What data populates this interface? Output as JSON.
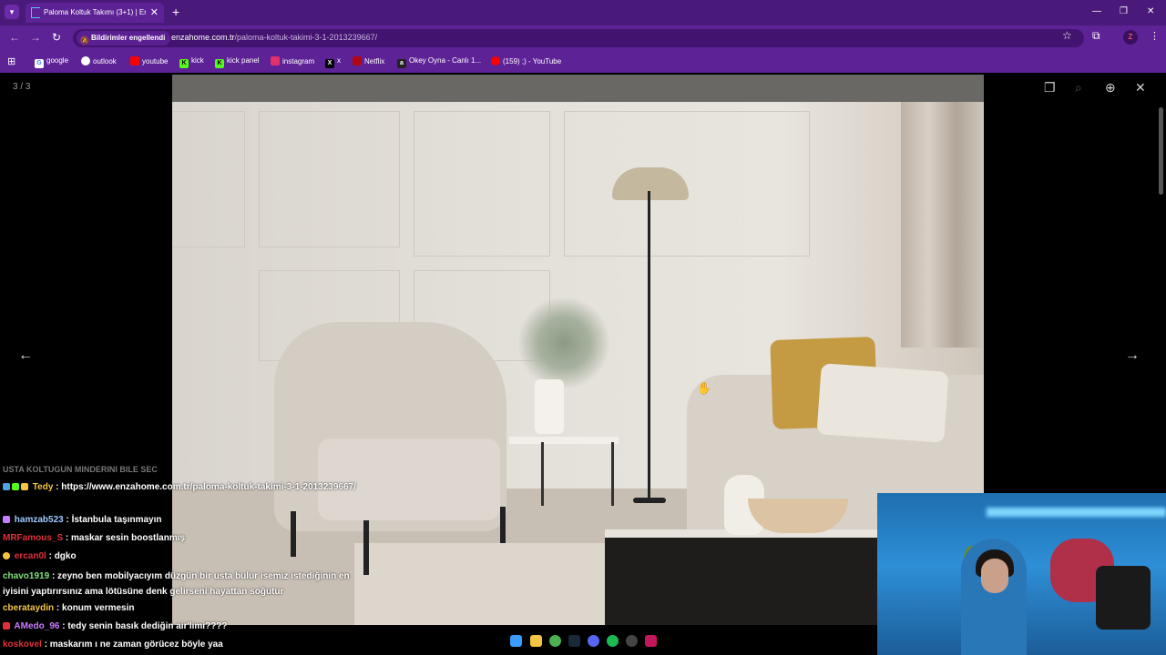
{
  "browser": {
    "tab_title": "Paloma Koltuk Takımı (3+1) | En",
    "tab_close": "✕",
    "new_tab": "+",
    "window_controls": [
      "—",
      "❐",
      "✕"
    ],
    "notifications_blocked": "Bildirimler engellendi",
    "url_domain": "enzahome.com.tr",
    "url_path": "/paloma-koltuk-takimi-3-1-2013239667/",
    "profile_initial": "Z"
  },
  "bookmarks": [
    {
      "label": "google",
      "icon": "google-icon",
      "color": "#ffffff"
    },
    {
      "label": "outlook",
      "icon": "outlook-icon",
      "color": "#ffffff"
    },
    {
      "label": "youtube",
      "icon": "youtube-icon",
      "color": "#ff0000"
    },
    {
      "label": "kick",
      "icon": "kick-icon",
      "color": "#53fc18"
    },
    {
      "label": "kick panel",
      "icon": "kick-icon",
      "color": "#53fc18"
    },
    {
      "label": "instagram",
      "icon": "instagram-icon",
      "color": "#e1306c"
    },
    {
      "label": "x",
      "icon": "x-icon",
      "color": "#000000"
    },
    {
      "label": "Netflix",
      "icon": "netflix-icon",
      "color": "#b20710"
    },
    {
      "label": "Okey Oyna - Canlı 1...",
      "icon": "okey-icon",
      "color": "#222222"
    },
    {
      "label": "(159) ;) - YouTube",
      "icon": "youtube-icon",
      "color": "#ff0000"
    }
  ],
  "lightbox": {
    "counter": "3 / 3"
  },
  "chat": {
    "faded_message": "USTA KOLTUGUN MINDERINI BILE SEC",
    "messages": [
      {
        "user": "Tedy",
        "color": "#f5c542",
        "text": ": https://www.enzahome.com.tr/paloma-koltuk-takimi-3-1-2013239667/"
      },
      {
        "user": "hamzab523",
        "color": "#9ecbff",
        "text": ": İstanbula taşınmayın"
      },
      {
        "user": "MRFamous_S",
        "color": "#e0303a",
        "text": ": maskar sesin boostlanmış"
      },
      {
        "user": "ercan0l",
        "color": "#e0303a",
        "text": ": dgko"
      },
      {
        "user": "chavo1919",
        "color": "#7fe07f",
        "text": ": zeyno ben mobilyacıyım düzgün bir usta bulur isemiz istediğinin en iyisini yaptırırsınız ama lötüsüne denk gelirseni hayattan soğutur"
      },
      {
        "user": "cberataydin",
        "color": "#f5c542",
        "text": ": konum vermesin"
      },
      {
        "user": "AMedo_96",
        "color": "#c77dff",
        "text": ": tedy senin basık dediğin air'limi????"
      },
      {
        "user": "koskovel",
        "color": "#e0303a",
        "text": ": maskarım ı ne zaman görücez böyle yaa"
      }
    ]
  },
  "taskbar_apps": [
    "windows-start-icon",
    "file-explorer-icon",
    "chrome-icon",
    "steam-icon",
    "discord-icon",
    "spotify-icon",
    "obs-icon",
    "steam-active-icon"
  ],
  "colors": {
    "browser_frame": "#5d2296",
    "tabbar": "#4a1a7a"
  }
}
